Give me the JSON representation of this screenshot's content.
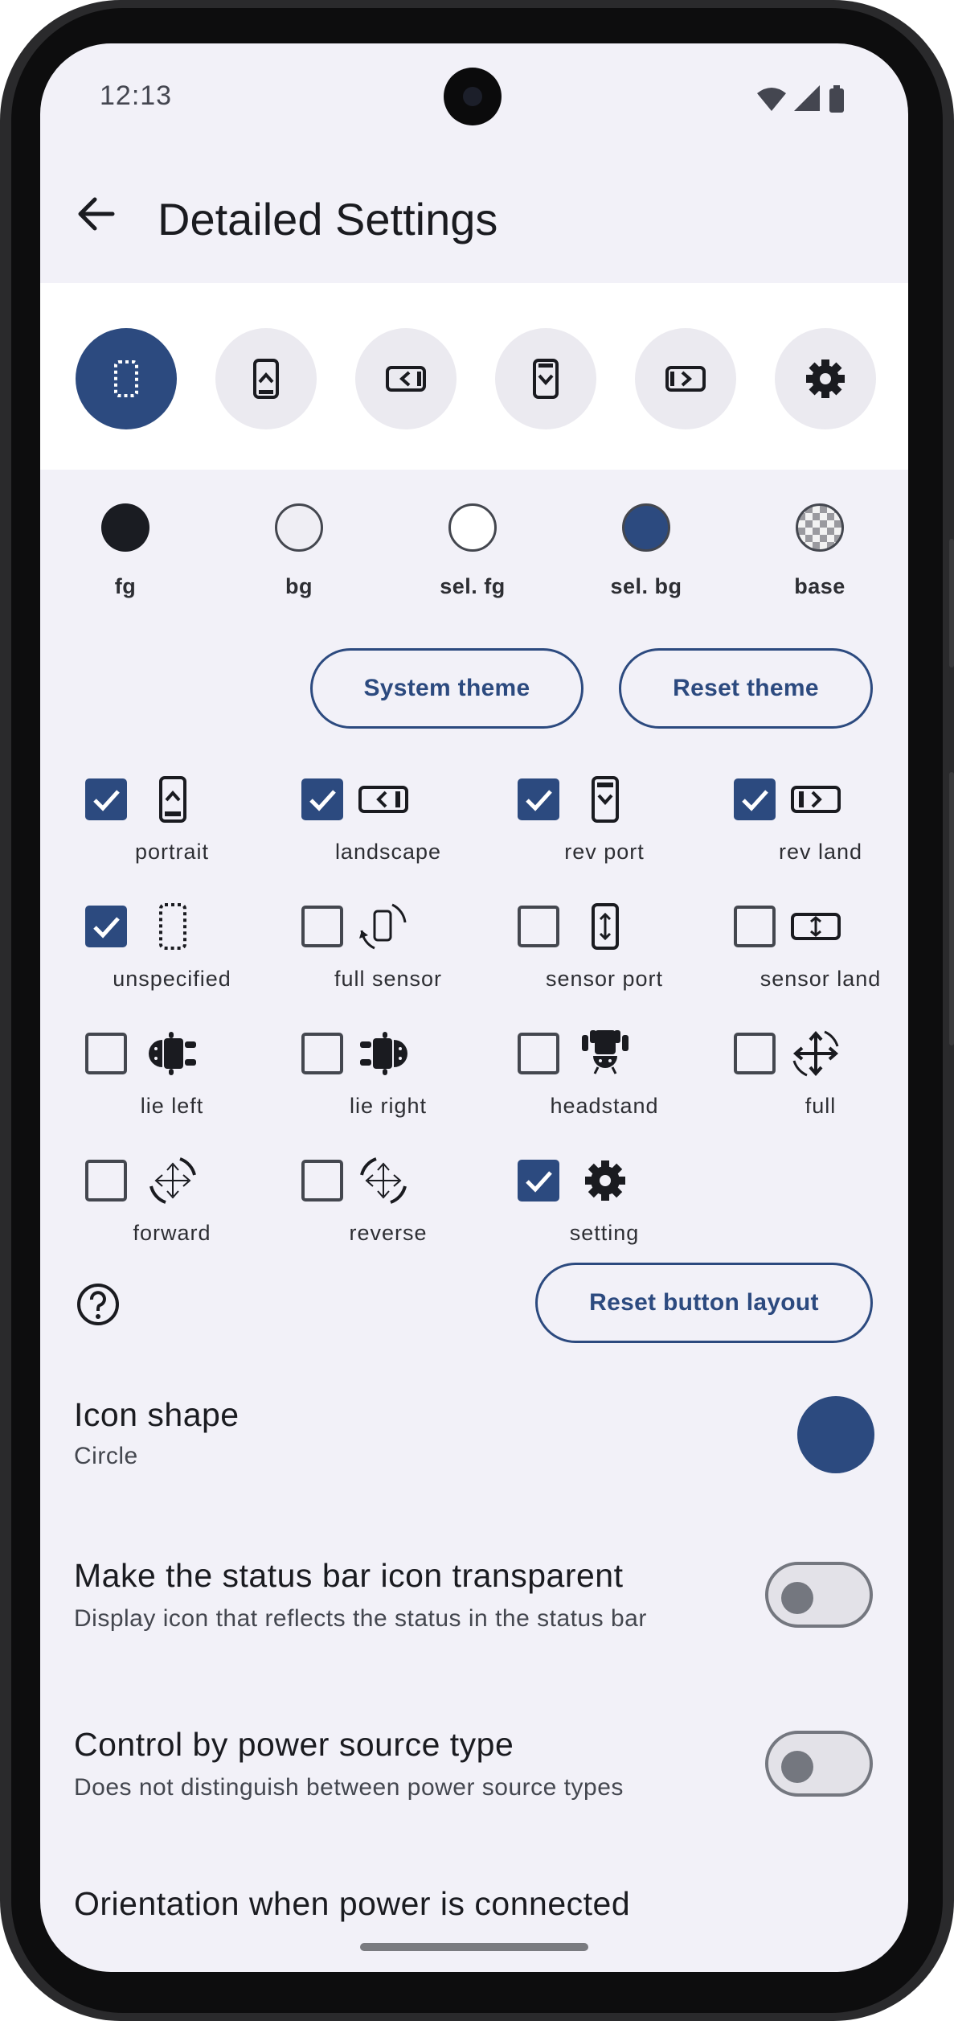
{
  "status": {
    "time": "12:13"
  },
  "header": {
    "title": "Detailed Settings"
  },
  "modes": [
    {
      "name": "unspecified",
      "selected": true,
      "icon": "dashed-rect-icon"
    },
    {
      "name": "portrait",
      "selected": false,
      "icon": "phone-portrait-icon"
    },
    {
      "name": "landscape",
      "selected": false,
      "icon": "phone-landscape-icon"
    },
    {
      "name": "rev port",
      "selected": false,
      "icon": "phone-reverse-portrait-icon"
    },
    {
      "name": "rev land",
      "selected": false,
      "icon": "phone-reverse-landscape-icon"
    },
    {
      "name": "setting",
      "selected": false,
      "icon": "gear-icon"
    }
  ],
  "swatches": [
    {
      "label": "fg",
      "color": "#1a1c22"
    },
    {
      "label": "bg",
      "color": "#efeef4"
    },
    {
      "label": "sel. fg",
      "color": "#ffffff"
    },
    {
      "label": "sel. bg",
      "color": "#2c4a7f"
    },
    {
      "label": "base",
      "color": "checker"
    }
  ],
  "buttons": {
    "system_theme": "System theme",
    "reset_theme": "Reset theme",
    "reset_layout": "Reset button layout"
  },
  "options": [
    {
      "label": "portrait",
      "checked": true,
      "icon": "phone-portrait-icon"
    },
    {
      "label": "landscape",
      "checked": true,
      "icon": "phone-landscape-icon"
    },
    {
      "label": "rev port",
      "checked": true,
      "icon": "phone-reverse-portrait-icon"
    },
    {
      "label": "rev land",
      "checked": true,
      "icon": "phone-reverse-landscape-icon"
    },
    {
      "label": "unspecified",
      "checked": true,
      "icon": "dashed-rect-icon"
    },
    {
      "label": "full sensor",
      "checked": false,
      "icon": "phone-rotate-icon"
    },
    {
      "label": "sensor port",
      "checked": false,
      "icon": "sensor-portrait-icon"
    },
    {
      "label": "sensor land",
      "checked": false,
      "icon": "sensor-landscape-icon"
    },
    {
      "label": "lie left",
      "checked": false,
      "icon": "android-lie-left-icon"
    },
    {
      "label": "lie right",
      "checked": false,
      "icon": "android-lie-right-icon"
    },
    {
      "label": "headstand",
      "checked": false,
      "icon": "android-headstand-icon"
    },
    {
      "label": "full",
      "checked": false,
      "icon": "move-rotate-icon"
    },
    {
      "label": "forward",
      "checked": false,
      "icon": "move-rotate-forward-icon"
    },
    {
      "label": "reverse",
      "checked": false,
      "icon": "move-rotate-reverse-icon"
    },
    {
      "label": "setting",
      "checked": true,
      "icon": "gear-icon"
    }
  ],
  "settings": {
    "icon_shape": {
      "title": "Icon shape",
      "value": "Circle",
      "color": "#2c4a7f"
    },
    "status_bar": {
      "title": "Make the status bar icon transparent",
      "subtitle": "Display icon that reflects the status in the status bar",
      "enabled": false
    },
    "power_source": {
      "title": "Control by power source type",
      "subtitle": "Does not distinguish between power source types",
      "enabled": false
    },
    "orientation_power": {
      "title": "Orientation when power is connected"
    }
  },
  "colors": {
    "accent": "#2c4a7f",
    "background": "#f2f1f8"
  }
}
